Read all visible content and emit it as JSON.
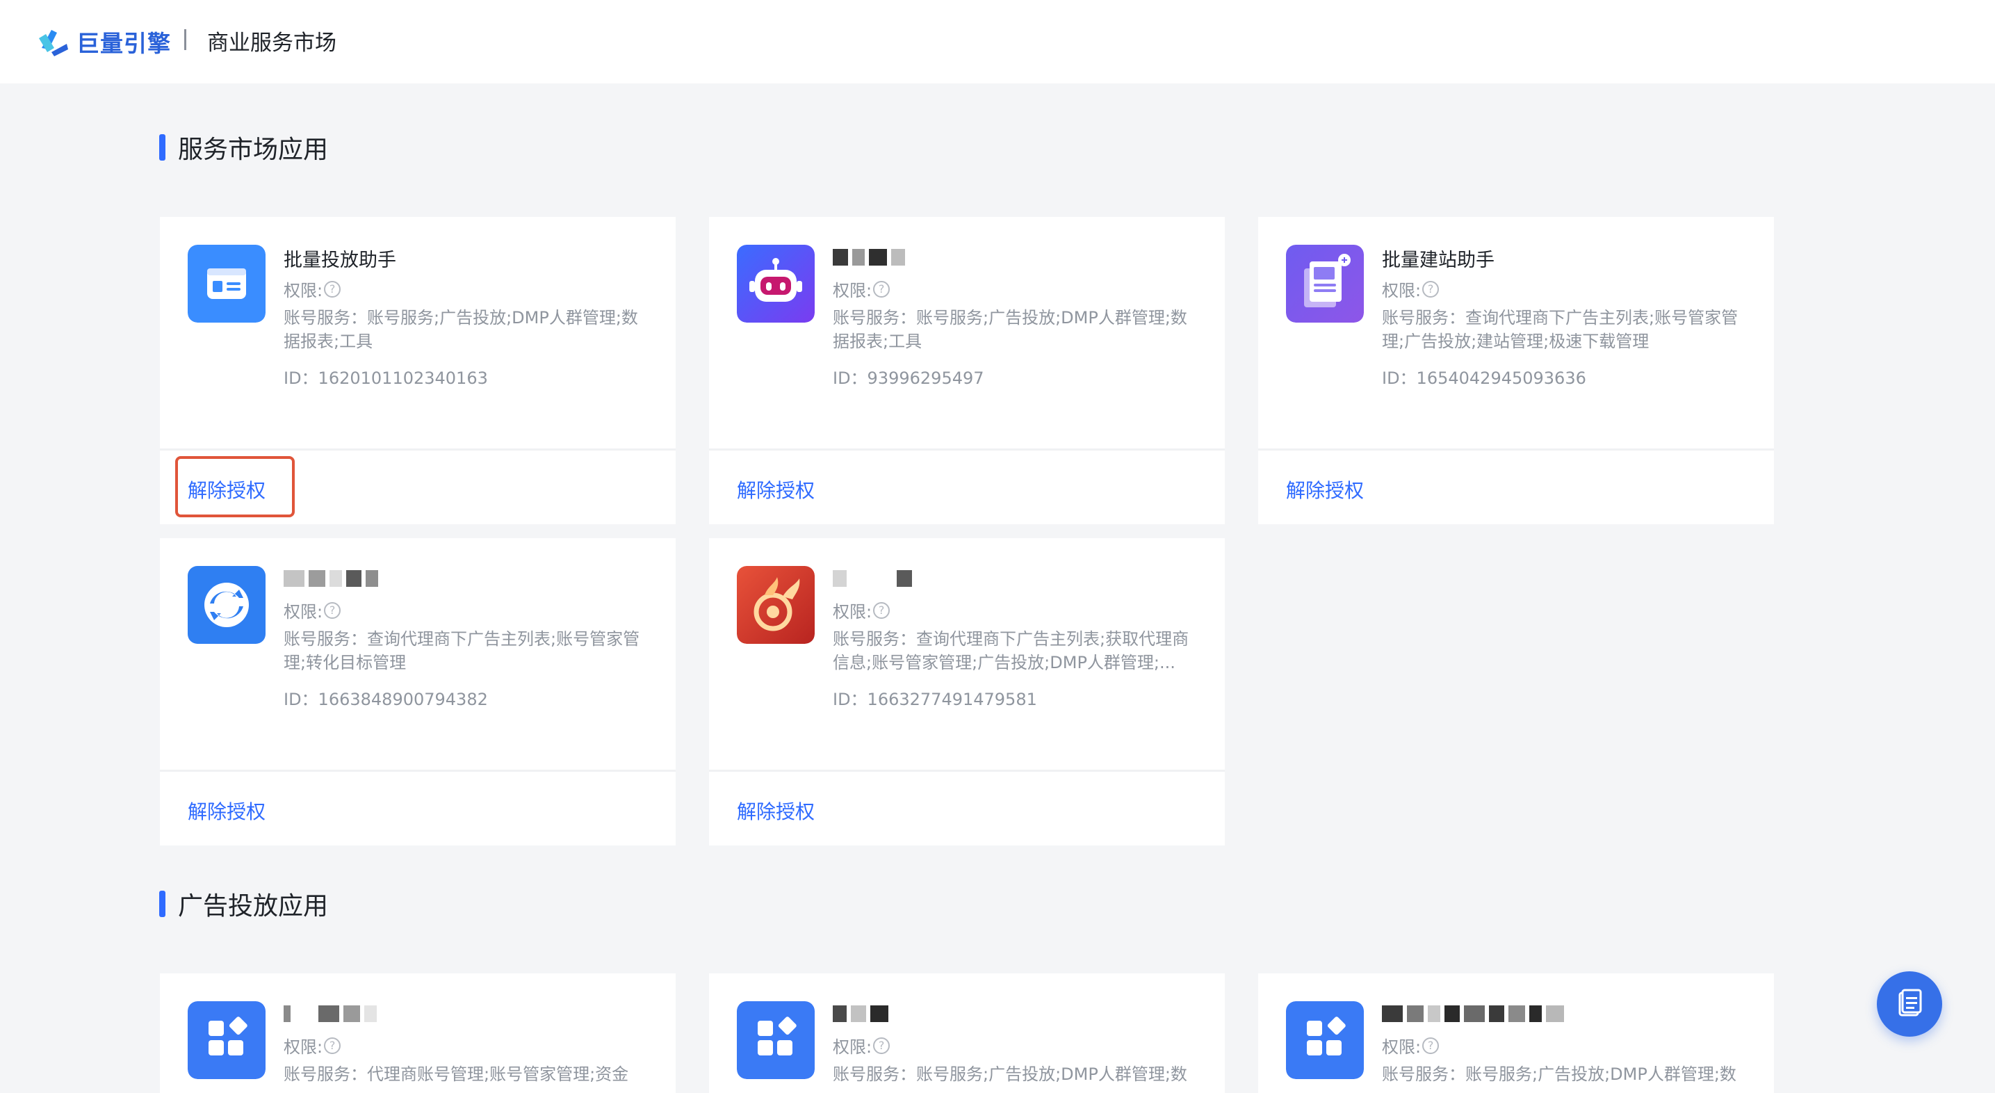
{
  "header": {
    "logo_text": "巨量引擎",
    "title": "商业服务市场"
  },
  "sections": [
    {
      "title": "服务市场应用",
      "cards": [
        {
          "name": "批量投放助手",
          "name_visible": true,
          "icon": "ad-form-icon",
          "perm_label": "权限:",
          "desc": "账号服务：账号服务;广告投放;DMP人群管理;数据报表;工具",
          "id": "ID：1620101102340163",
          "action": "解除授权",
          "highlighted": true
        },
        {
          "name": "",
          "name_visible": false,
          "icon": "robot-icon",
          "perm_label": "权限:",
          "desc": "账号服务：账号服务;广告投放;DMP人群管理;数据报表;工具",
          "id": "ID：93996295497",
          "action": "解除授权",
          "highlighted": false
        },
        {
          "name": "批量建站助手",
          "name_visible": true,
          "icon": "document-stack-icon",
          "perm_label": "权限:",
          "desc": "账号服务：查询代理商下广告主列表;账号管家管理;广告投放;建站管理;极速下载管理",
          "id": "ID：1654042945093636",
          "action": "解除授权",
          "highlighted": false
        },
        {
          "name": "",
          "name_visible": false,
          "icon": "sync-arrows-icon",
          "perm_label": "权限:",
          "desc": "账号服务：查询代理商下广告主列表;账号管家管理;转化目标管理",
          "id": "ID：1663848900794382",
          "action": "解除授权",
          "highlighted": false
        },
        {
          "name": "",
          "name_visible": false,
          "icon": "flame-ring-icon",
          "perm_label": "权限:",
          "desc": "账号服务：查询代理商下广告主列表;获取代理商信息;账号管家管理;广告投放;DMP人群管理;...",
          "id": "ID：1663277491479581",
          "action": "解除授权",
          "highlighted": false
        }
      ]
    },
    {
      "title": "广告投放应用",
      "cards": [
        {
          "name": "",
          "icon": "apps-grid-icon",
          "perm_label": "权限:",
          "desc": "账号服务：代理商账号管理;账号管家管理;资金"
        },
        {
          "name": "",
          "icon": "apps-grid-icon",
          "perm_label": "权限:",
          "desc": "账号服务：账号服务;广告投放;DMP人群管理;数"
        },
        {
          "name": "",
          "icon": "apps-grid-icon",
          "perm_label": "权限:",
          "desc": "账号服务：账号服务;广告投放;DMP人群管理;数"
        }
      ]
    }
  ],
  "help_glyph": "?",
  "colors": {
    "accent": "#2f6bff",
    "highlight_border": "#e0553a",
    "float_button": "#3670e8"
  },
  "float_button_icon": "document-list-icon"
}
